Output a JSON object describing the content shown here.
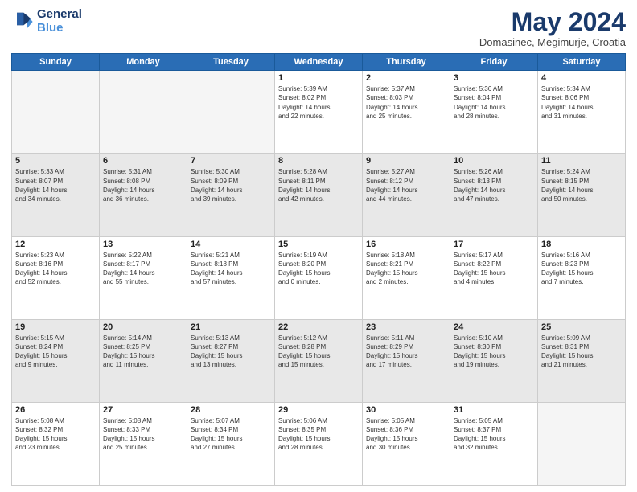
{
  "logo": {
    "text1": "General",
    "text2": "Blue"
  },
  "title": {
    "month_year": "May 2024",
    "location": "Domasinec, Megimurje, Croatia"
  },
  "header": {
    "days": [
      "Sunday",
      "Monday",
      "Tuesday",
      "Wednesday",
      "Thursday",
      "Friday",
      "Saturday"
    ]
  },
  "weeks": [
    [
      {
        "day": "",
        "info": "",
        "empty": true
      },
      {
        "day": "",
        "info": "",
        "empty": true
      },
      {
        "day": "",
        "info": "",
        "empty": true
      },
      {
        "day": "1",
        "info": "Sunrise: 5:39 AM\nSunset: 8:02 PM\nDaylight: 14 hours\nand 22 minutes."
      },
      {
        "day": "2",
        "info": "Sunrise: 5:37 AM\nSunset: 8:03 PM\nDaylight: 14 hours\nand 25 minutes."
      },
      {
        "day": "3",
        "info": "Sunrise: 5:36 AM\nSunset: 8:04 PM\nDaylight: 14 hours\nand 28 minutes."
      },
      {
        "day": "4",
        "info": "Sunrise: 5:34 AM\nSunset: 8:06 PM\nDaylight: 14 hours\nand 31 minutes."
      }
    ],
    [
      {
        "day": "5",
        "info": "Sunrise: 5:33 AM\nSunset: 8:07 PM\nDaylight: 14 hours\nand 34 minutes.",
        "shaded": true
      },
      {
        "day": "6",
        "info": "Sunrise: 5:31 AM\nSunset: 8:08 PM\nDaylight: 14 hours\nand 36 minutes.",
        "shaded": true
      },
      {
        "day": "7",
        "info": "Sunrise: 5:30 AM\nSunset: 8:09 PM\nDaylight: 14 hours\nand 39 minutes.",
        "shaded": true
      },
      {
        "day": "8",
        "info": "Sunrise: 5:28 AM\nSunset: 8:11 PM\nDaylight: 14 hours\nand 42 minutes.",
        "shaded": true
      },
      {
        "day": "9",
        "info": "Sunrise: 5:27 AM\nSunset: 8:12 PM\nDaylight: 14 hours\nand 44 minutes.",
        "shaded": true
      },
      {
        "day": "10",
        "info": "Sunrise: 5:26 AM\nSunset: 8:13 PM\nDaylight: 14 hours\nand 47 minutes.",
        "shaded": true
      },
      {
        "day": "11",
        "info": "Sunrise: 5:24 AM\nSunset: 8:15 PM\nDaylight: 14 hours\nand 50 minutes.",
        "shaded": true
      }
    ],
    [
      {
        "day": "12",
        "info": "Sunrise: 5:23 AM\nSunset: 8:16 PM\nDaylight: 14 hours\nand 52 minutes."
      },
      {
        "day": "13",
        "info": "Sunrise: 5:22 AM\nSunset: 8:17 PM\nDaylight: 14 hours\nand 55 minutes."
      },
      {
        "day": "14",
        "info": "Sunrise: 5:21 AM\nSunset: 8:18 PM\nDaylight: 14 hours\nand 57 minutes."
      },
      {
        "day": "15",
        "info": "Sunrise: 5:19 AM\nSunset: 8:20 PM\nDaylight: 15 hours\nand 0 minutes."
      },
      {
        "day": "16",
        "info": "Sunrise: 5:18 AM\nSunset: 8:21 PM\nDaylight: 15 hours\nand 2 minutes."
      },
      {
        "day": "17",
        "info": "Sunrise: 5:17 AM\nSunset: 8:22 PM\nDaylight: 15 hours\nand 4 minutes."
      },
      {
        "day": "18",
        "info": "Sunrise: 5:16 AM\nSunset: 8:23 PM\nDaylight: 15 hours\nand 7 minutes."
      }
    ],
    [
      {
        "day": "19",
        "info": "Sunrise: 5:15 AM\nSunset: 8:24 PM\nDaylight: 15 hours\nand 9 minutes.",
        "shaded": true
      },
      {
        "day": "20",
        "info": "Sunrise: 5:14 AM\nSunset: 8:25 PM\nDaylight: 15 hours\nand 11 minutes.",
        "shaded": true
      },
      {
        "day": "21",
        "info": "Sunrise: 5:13 AM\nSunset: 8:27 PM\nDaylight: 15 hours\nand 13 minutes.",
        "shaded": true
      },
      {
        "day": "22",
        "info": "Sunrise: 5:12 AM\nSunset: 8:28 PM\nDaylight: 15 hours\nand 15 minutes.",
        "shaded": true
      },
      {
        "day": "23",
        "info": "Sunrise: 5:11 AM\nSunset: 8:29 PM\nDaylight: 15 hours\nand 17 minutes.",
        "shaded": true
      },
      {
        "day": "24",
        "info": "Sunrise: 5:10 AM\nSunset: 8:30 PM\nDaylight: 15 hours\nand 19 minutes.",
        "shaded": true
      },
      {
        "day": "25",
        "info": "Sunrise: 5:09 AM\nSunset: 8:31 PM\nDaylight: 15 hours\nand 21 minutes.",
        "shaded": true
      }
    ],
    [
      {
        "day": "26",
        "info": "Sunrise: 5:08 AM\nSunset: 8:32 PM\nDaylight: 15 hours\nand 23 minutes."
      },
      {
        "day": "27",
        "info": "Sunrise: 5:08 AM\nSunset: 8:33 PM\nDaylight: 15 hours\nand 25 minutes."
      },
      {
        "day": "28",
        "info": "Sunrise: 5:07 AM\nSunset: 8:34 PM\nDaylight: 15 hours\nand 27 minutes."
      },
      {
        "day": "29",
        "info": "Sunrise: 5:06 AM\nSunset: 8:35 PM\nDaylight: 15 hours\nand 28 minutes."
      },
      {
        "day": "30",
        "info": "Sunrise: 5:05 AM\nSunset: 8:36 PM\nDaylight: 15 hours\nand 30 minutes."
      },
      {
        "day": "31",
        "info": "Sunrise: 5:05 AM\nSunset: 8:37 PM\nDaylight: 15 hours\nand 32 minutes."
      },
      {
        "day": "",
        "info": "",
        "empty": true
      }
    ]
  ]
}
